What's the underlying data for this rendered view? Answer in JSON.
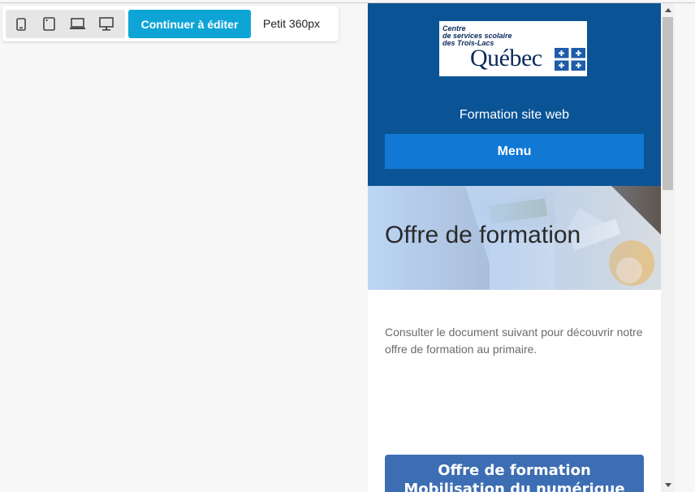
{
  "toolbar": {
    "devices": [
      {
        "icon": "mobile-icon"
      },
      {
        "icon": "tablet-icon"
      },
      {
        "icon": "laptop-icon"
      },
      {
        "icon": "desktop-icon"
      }
    ],
    "continue_label": "Continuer à éditer",
    "size_label": "Petit 360px"
  },
  "site": {
    "logo": {
      "line1": "Centre",
      "line2": "de services scolaire",
      "line3": "des Trois-Lacs",
      "wordmark": "Québec"
    },
    "title": "Formation site web",
    "menu_label": "Menu",
    "hero_title": "Offre de formation",
    "intro": "Consulter le document suivant pour découvrir notre offre de formation au primaire.",
    "cta_line1": "Offre de formation",
    "cta_line2": "Mobilisation du numérique"
  },
  "colors": {
    "accent": "#0ea5d6",
    "header_bg": "#0a5496",
    "menu_bg": "#1179d4",
    "cta_bg": "#3d6eb3"
  }
}
